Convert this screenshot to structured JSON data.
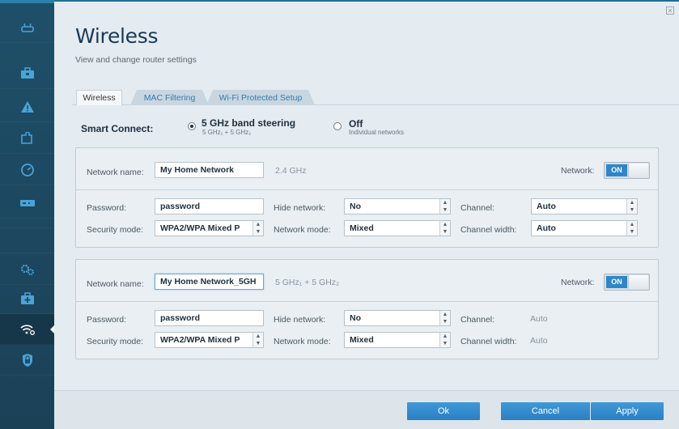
{
  "header": {
    "title": "Wireless",
    "subtitle": "View and change router settings",
    "close_glyph": "×"
  },
  "sidebar": {
    "items": [
      {
        "icon": "router-icon"
      },
      {
        "icon": "toolbox-icon"
      },
      {
        "icon": "warning-icon"
      },
      {
        "icon": "puzzle-icon"
      },
      {
        "icon": "speed-icon"
      },
      {
        "icon": "storage-icon"
      },
      {
        "icon": "gears-icon"
      },
      {
        "icon": "medkit-icon"
      },
      {
        "icon": "wifi-settings-icon"
      },
      {
        "icon": "lock-icon"
      }
    ],
    "active_icon": "wifi-settings-icon"
  },
  "tabs": [
    {
      "label": "Wireless"
    },
    {
      "label": "MAC Filtering"
    },
    {
      "label": "Wi-Fi Protected Setup"
    }
  ],
  "smart_connect": {
    "label": "Smart Connect:",
    "option1_title": "5 GHz band steering",
    "option1_sub": "5 GHz₁ + 5 GHz₂",
    "option2_title": "Off",
    "option2_sub": "Individual networks",
    "selected": "5 GHz band steering"
  },
  "networks": [
    {
      "name_label": "Network name:",
      "name": "My Home Network",
      "band": "2.4 GHz",
      "network_label": "Network:",
      "toggle": "ON",
      "password_label": "Password:",
      "password": "password",
      "security_label": "Security mode:",
      "security": "WPA2/WPA Mixed P",
      "hide_label": "Hide network:",
      "hide": "No",
      "mode_label": "Network mode:",
      "mode": "Mixed",
      "channel_label": "Channel:",
      "channel": "Auto",
      "width_label": "Channel width:",
      "width": "Auto"
    },
    {
      "name_label": "Network name:",
      "name": "My Home Network_5GH",
      "band": "5 GHz₁ + 5 GHz₂",
      "network_label": "Network:",
      "toggle": "ON",
      "password_label": "Password:",
      "password": "password",
      "security_label": "Security mode:",
      "security": "WPA2/WPA Mixed P",
      "hide_label": "Hide network:",
      "hide": "No",
      "mode_label": "Network mode:",
      "mode": "Mixed",
      "channel_label": "Channel:",
      "channel": "Auto",
      "width_label": "Channel width:",
      "width": "Auto"
    }
  ],
  "footer": {
    "ok": "Ok",
    "cancel": "Cancel",
    "apply": "Apply"
  },
  "colors": {
    "accent": "#2d86c9",
    "sidebar": "#1e4f69",
    "panel": "#e4ebf1"
  }
}
